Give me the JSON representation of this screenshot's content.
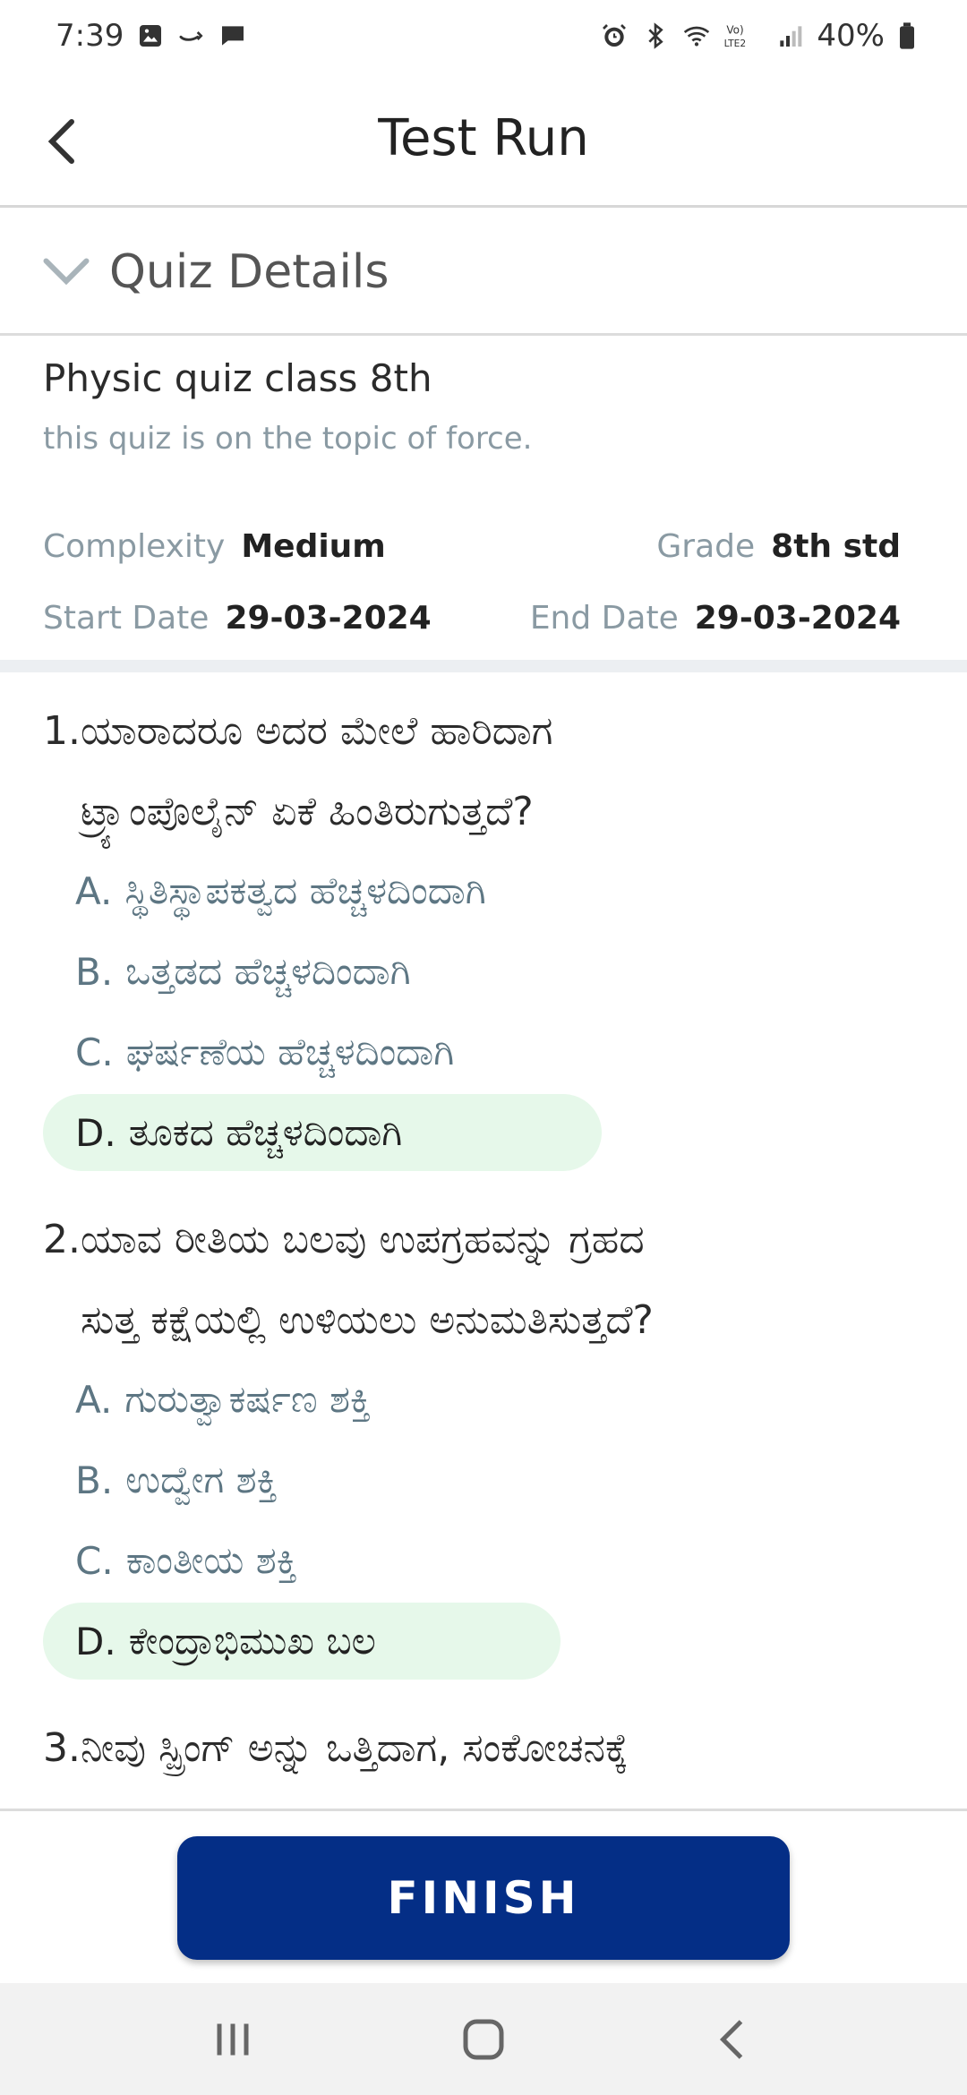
{
  "status_bar": {
    "time": "7:39",
    "battery": "40%"
  },
  "app_bar": {
    "title": "Test Run"
  },
  "quiz_details": {
    "header": "Quiz Details",
    "name": "Physic quiz class 8th",
    "description": "this quiz is on the topic of force.",
    "complexity_label": "Complexity",
    "complexity_value": "Medium",
    "grade_label": "Grade",
    "grade_value": "8th std",
    "start_label": "Start Date",
    "start_value": "29-03-2024",
    "end_label": "End Date",
    "end_value": "29-03-2024"
  },
  "questions": [
    {
      "line1": "1.ಯಾರಾದರೂ ಅದರ ಮೇಲೆ ಹಾರಿದಾಗ",
      "line2": "ಟ್ರ್ಯಾಂಪೊಲೈನ್ ಏಕೆ ಹಿಂತಿರುಗುತ್ತದೆ?",
      "options": [
        {
          "letter": "A.",
          "text": "ಸ್ಥಿತಿಸ್ಥಾಪಕತ್ವದ ಹೆಚ್ಚಳದಿಂದಾಗಿ"
        },
        {
          "letter": "B.",
          "text": "ಒತ್ತಡದ ಹೆಚ್ಚಳದಿಂದಾಗಿ"
        },
        {
          "letter": "C.",
          "text": "ಘರ್ಷಣೆಯ ಹೆಚ್ಚಳದಿಂದಾಗಿ"
        },
        {
          "letter": "D.",
          "text": "ತೂಕದ ಹೆಚ್ಚಳದಿಂದಾಗಿ"
        }
      ]
    },
    {
      "line1": "2.ಯಾವ ರೀತಿಯ ಬಲವು ಉಪಗ್ರಹವನ್ನು ಗ್ರಹದ",
      "line2": "ಸುತ್ತ ಕಕ್ಷೆಯಲ್ಲಿ ಉಳಿಯಲು ಅನುಮತಿಸುತ್ತದೆ?",
      "options": [
        {
          "letter": "A.",
          "text": "ಗುರುತ್ವಾಕರ್ಷಣ ಶಕ್ತಿ"
        },
        {
          "letter": "B.",
          "text": "ಉದ್ವೇಗ ಶಕ್ತಿ"
        },
        {
          "letter": "C.",
          "text": "ಕಾಂತೀಯ ಶಕ್ತಿ"
        },
        {
          "letter": "D.",
          "text": "ಕೇಂದ್ರಾಭಿಮುಖ ಬಲ"
        }
      ]
    },
    {
      "line1": "3.ನೀವು ಸ್ಪ್ರಿಂಗ್ ಅನ್ನು ಒತ್ತಿದಾಗ, ಸಂಕೋಚನಕ್ಕೆ"
    }
  ],
  "finish_label": "FINISH",
  "colors": {
    "primary": "#042e86",
    "correct_bg": "#e6f8ea",
    "muted": "#8a9aa3",
    "option": "#5d7683"
  }
}
